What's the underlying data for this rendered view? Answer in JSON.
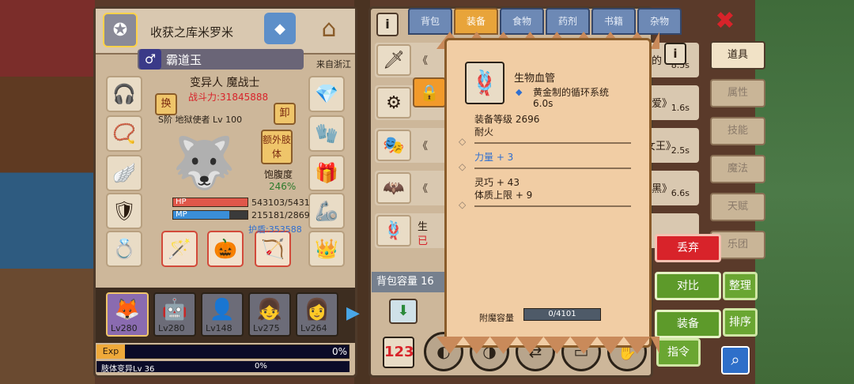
{
  "character": {
    "guild_name": "收获之库米罗米",
    "name": "霸道玉",
    "origin": "来自浙江",
    "class": "变异人 魔战士",
    "power": "战斗力:31845888",
    "rank": "S阶 地狱使者 Lv 100",
    "swap_label": "换",
    "unequip_label": "卸",
    "extra_limb_label": "额外肢体",
    "satiety_label": "饱腹度",
    "satiety_value": "246%",
    "hp_label": "HP",
    "hp_value": "543103/5431",
    "hp_ratio": 1.0,
    "mp_label": "MP",
    "mp_value": "215181/2869",
    "mp_ratio": 0.75,
    "shield": "护盾:353588",
    "party": [
      {
        "level": "Lv280"
      },
      {
        "level": "Lv280"
      },
      {
        "level": "Lv148"
      },
      {
        "level": "Lv275"
      },
      {
        "level": "Lv264"
      }
    ],
    "exp_label": "Exp",
    "exp_value": "0%",
    "skill_label": "肢体变异Lv 36",
    "skill_value": "0%"
  },
  "inventory": {
    "tabs": [
      "背包",
      "装备",
      "食物",
      "药剂",
      "书籍",
      "杂物"
    ],
    "active_tab": "装备",
    "items": [
      {
        "text": "《",
        "time": "8.5s",
        "suffix": "的"
      },
      {
        "text": "",
        "time": "1.6s",
        "suffix": "爱》"
      },
      {
        "text": "《",
        "time": "2.5s",
        "suffix": "女王》"
      },
      {
        "text": "《",
        "time": "6.6s",
        "suffix": "黑》"
      },
      {
        "text": "生",
        "time": "",
        "suffix": "已"
      }
    ],
    "capacity_label": "背包容量 16"
  },
  "side_tabs": [
    "道具",
    "属性",
    "技能",
    "魔法",
    "天赋",
    "乐团"
  ],
  "actions": {
    "discard": "丢弃",
    "compare": "对比",
    "arrange": "整理",
    "equip": "装备",
    "sort": "排序",
    "command": "指令"
  },
  "tooltip": {
    "title": "生物血管",
    "subtitle": "黄金制的循环系统",
    "time": "6.0s",
    "level": "装备等级 2696",
    "trait": "耐火",
    "stat_power": "力量 + 3",
    "stat_agility": "灵巧 + 43",
    "stat_body": "体质上限 + 9",
    "enchant_label": "附魔容量",
    "enchant_value": "0/4101"
  },
  "colors": {
    "accent_orange": "#e8a43a",
    "tab_blue": "#6d89b5",
    "discard_red": "#d8232a",
    "action_green": "#5d9a2a",
    "power_red": "#d8232a",
    "shield_blue": "#2f6fd0"
  }
}
